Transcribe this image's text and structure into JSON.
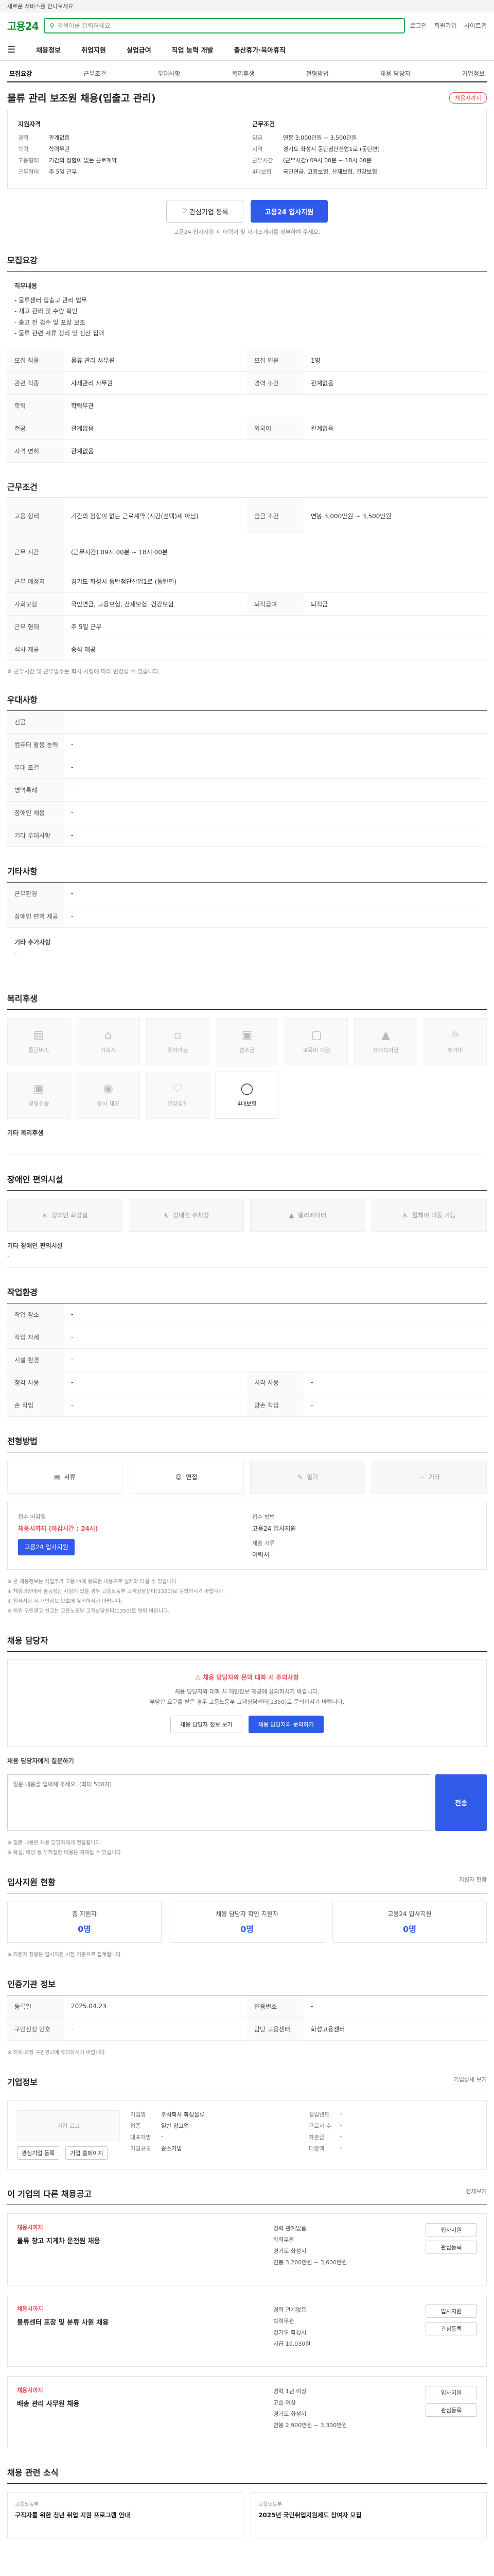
{
  "topbar": {
    "text": "새로운 서비스를 만나보세요"
  },
  "gnb": {
    "logo": "고용24",
    "search_placeholder": "검색어를 입력하세요",
    "links": [
      "로그인",
      "회원가입",
      "사이트맵"
    ]
  },
  "menu": {
    "items": [
      "채용정보",
      "취업지원",
      "실업급여",
      "직업 능력 개발",
      "출산휴가·육아휴직"
    ]
  },
  "tabs": [
    "모집요강",
    "근무조건",
    "우대사항",
    "복리후생",
    "전형방법",
    "채용 담당자",
    "기업정보"
  ],
  "job": {
    "title": "물류 관리 보조원 채용(입출고 관리)",
    "badge": "채용시까지",
    "summary_left_title": "지원자격",
    "summary_left": [
      {
        "k": "경력",
        "v": "관계없음"
      },
      {
        "k": "학력",
        "v": "학력무관"
      },
      {
        "k": "고용형태",
        "v": "기간의 정함이 없는 근로계약"
      },
      {
        "k": "근무형태",
        "v": "주 5일 근무"
      }
    ],
    "summary_right_title": "근무조건",
    "summary_right": [
      {
        "k": "임금",
        "v": "연봉 3,000만원 ~ 3,500만원"
      },
      {
        "k": "지역",
        "v": "경기도 화성시 동탄첨단산업1로 (동탄면)"
      },
      {
        "k": "근무시간",
        "v": "(근무시간) 09시 00분 ~ 18시 00분"
      },
      {
        "k": "4대보험",
        "v": "국민연금, 고용보험, 산재보험, 건강보험"
      }
    ],
    "btn_scrap": "관심기업 등록",
    "btn_apply": "고용24 입사지원",
    "note": "고용24 입사지원 시 이력서 및 자기소개서를 첨부하여 주세요."
  },
  "recruit": {
    "title": "모집요강",
    "job_desc_label": "직무내용",
    "job_desc": "- 물류센터 입출고 관리 업무\n- 재고 관리 및 수량 확인\n- 출고 전 검수 및 포장 보조\n- 물류 관련 서류 정리 및 전산 입력",
    "rows": [
      {
        "k1": "모집 직종",
        "v1": "물류 관리 사무원",
        "k2": "모집 인원",
        "v2": "1명"
      },
      {
        "k1": "관련 직종",
        "v1": "자재관리 사무원",
        "k2": "경력 조건",
        "v2": "관계없음"
      },
      {
        "k1": "학력",
        "v1": "학력무관",
        "k2": "",
        "v2": ""
      },
      {
        "k1": "전공",
        "v1": "관계없음",
        "k2": "외국어",
        "v2": "관계없음"
      },
      {
        "k1": "자격 면허",
        "v1": "관계없음",
        "k2": "",
        "v2": ""
      }
    ]
  },
  "conditions": {
    "title": "근무조건",
    "rows": [
      {
        "k1": "고용 형태",
        "v1": "기간의 정함이 없는 근로계약 (시간(선택)제 아님)",
        "k2": "임금 조건",
        "v2": "연봉 3,000만원 ~ 3,500만원"
      },
      {
        "k1": "근무 시간",
        "v1": "(근무시간) 09시 00분 ~ 18시 00분",
        "k2": "",
        "v2": ""
      },
      {
        "k1": "근무 예정지",
        "v1": "경기도 화성시 동탄첨단산업1로 (동탄면)",
        "k2": "",
        "v2": ""
      },
      {
        "k1": "사회보험",
        "v1": "국민연금, 고용보험, 산재보험, 건강보험",
        "k2": "퇴직급여",
        "v2": "퇴직금"
      },
      {
        "k1": "근무 형태",
        "v1": "주 5일 근무",
        "k2": "",
        "v2": ""
      },
      {
        "k1": "식사 제공",
        "v1": "중식 제공",
        "k2": "",
        "v2": ""
      }
    ],
    "note": "※ 근무시간 및 근무일수는 회사 사정에 따라 변경될 수 있습니다."
  },
  "prefer": {
    "title": "우대사항",
    "rows": [
      {
        "k": "전공",
        "v": "-"
      },
      {
        "k": "컴퓨터 활용 능력",
        "v": "-"
      },
      {
        "k": "우대 조건",
        "v": "-"
      },
      {
        "k": "병역특례",
        "v": "-"
      },
      {
        "k": "장애인 채용",
        "v": "-"
      },
      {
        "k": "기타 우대사항",
        "v": "-"
      }
    ]
  },
  "other": {
    "title": "기타사항",
    "rows": [
      {
        "k": "근무환경",
        "v": "-"
      },
      {
        "k": "장애인 편의 제공",
        "v": "-"
      }
    ],
    "extra_label": "기타 추가사항",
    "extra": "-"
  },
  "welfare": {
    "title": "복리후생",
    "items": [
      {
        "label": "통근버스",
        "icon": "bus-icon",
        "on": false
      },
      {
        "label": "기숙사",
        "icon": "home-icon",
        "on": false
      },
      {
        "label": "주차가능",
        "icon": "car-icon",
        "on": false
      },
      {
        "label": "경조금",
        "icon": "gift-icon",
        "on": false
      },
      {
        "label": "교육비 지원",
        "icon": "book-icon",
        "on": false
      },
      {
        "label": "자녀학자금",
        "icon": "school-icon",
        "on": false
      },
      {
        "label": "휴가비",
        "icon": "sun-icon",
        "on": false
      },
      {
        "label": "명절선물",
        "icon": "gift-icon",
        "on": false
      },
      {
        "label": "중식 제공",
        "icon": "meal-icon",
        "on": false
      },
      {
        "label": "건강검진",
        "icon": "heart-icon",
        "on": false
      },
      {
        "label": "4대보험",
        "icon": "shield-icon",
        "on": true
      }
    ],
    "extra_label": "기타 복리후생",
    "extra": "-"
  },
  "disability": {
    "title": "장애인 편의시설",
    "items": [
      "장애인 화장실",
      "장애인 주차장",
      "엘리베이터",
      "휠체어 이동 가능"
    ],
    "extra_label": "기타 장애인 편의시설",
    "extra": "-"
  },
  "workenv": {
    "title": "작업환경",
    "rows": [
      {
        "k1": "작업 장소",
        "v1": "-",
        "k2": "",
        "v2": ""
      },
      {
        "k1": "작업 자세",
        "v1": "-",
        "k2": "",
        "v2": ""
      },
      {
        "k1": "시설 환경",
        "v1": "-",
        "k2": "",
        "v2": ""
      },
      {
        "k1": "청각 사용",
        "v1": "-",
        "k2": "시각 사용",
        "v2": "-"
      },
      {
        "k1": "손 작업",
        "v1": "-",
        "k2": "양손 작업",
        "v2": "-"
      }
    ]
  },
  "selection": {
    "title": "전형방법",
    "steps": [
      "서류",
      "면접",
      "필기",
      "기타"
    ],
    "apply_label": "접수 마감일",
    "apply_deadline": "채용시까지 (마감시간 : 24시)",
    "method_label": "접수 방법",
    "method_value": "고용24 입사지원",
    "doc_label": "제출 서류",
    "doc_value": "이력서",
    "btn": "고용24 입사지원",
    "notices": [
      "※ 본 채용정보는 사업주가 고용24에 등록한 내용으로 실제와 다를 수 있습니다.",
      "※ 채용과정에서 불공정한 사항이 있을 경우 고용노동부 고객상담센터(1350)로 문의하시기 바랍니다.",
      "※ 입사지원 시 개인정보 보호에 유의하시기 바랍니다.",
      "※ 허위 구인광고 신고는 고용노동부 고객상담센터(1350)로 연락 바랍니다."
    ]
  },
  "contact": {
    "title": "채용 담당자",
    "warn": "채용 담당자와 문의 대화 시 주의사항",
    "desc": "채용 담당자와 대화 시 개인정보 제공에 유의하시기 바랍니다.\n부당한 요구를 받은 경우 고용노동부 고객상담센터(1350)로 문의하시기 바랍니다.",
    "btn1": "채용 담당자 정보 보기",
    "btn2": "채용 담당자와 문의하기",
    "inq_label": "채용 담당자에게 질문하기",
    "inq_placeholder": "질문 내용을 입력해 주세요. (최대 500자)",
    "inq_send": "전송",
    "notices": [
      "※ 질문 내용은 채용 담당자에게 전달됩니다.",
      "※ 욕설, 비방 등 부적절한 내용은 제재될 수 있습니다."
    ]
  },
  "stats": {
    "title": "입사지원 현황",
    "right": "지원자 현황",
    "items": [
      {
        "label": "총 지원자",
        "value": "0명"
      },
      {
        "label": "채용 담당자 확인 지원자",
        "value": "0명"
      },
      {
        "label": "고용24 입사지원",
        "value": "0명"
      }
    ],
    "note": "※ 지원자 현황은 입사지원 시점 기준으로 집계됩니다."
  },
  "admin": {
    "title": "인증기관 정보",
    "rows": [
      {
        "k1": "등록일",
        "v1": "2025.04.23",
        "k2": "인증번호",
        "v2": "-"
      },
      {
        "k1": "구인신청 번호",
        "v1": "-",
        "k2": "담당 고용센터",
        "v2": "화성고용센터"
      }
    ],
    "note": "※ 허위·과장 구인광고에 유의하시기 바랍니다."
  },
  "company": {
    "title": "기업정보",
    "right": "기업상세 보기",
    "logo_text": "기업 로고",
    "rows": [
      {
        "k": "기업명",
        "v": "주식회사 화성물류"
      },
      {
        "k": "업종",
        "v": "일반 창고업"
      },
      {
        "k": "대표자명",
        "v": "-"
      },
      {
        "k": "기업규모",
        "v": "중소기업"
      }
    ],
    "rows2": [
      {
        "k": "설립년도",
        "v": "-"
      },
      {
        "k": "근로자 수",
        "v": "-"
      },
      {
        "k": "자본금",
        "v": "-"
      },
      {
        "k": "매출액",
        "v": "-"
      }
    ],
    "btn1": "관심기업 등록",
    "btn2": "기업 홈페이지"
  },
  "similar": {
    "title": "이 기업의 다른 채용공고",
    "right": "전체보기",
    "cards": [
      {
        "tag": "채용시까지",
        "title": "물류 창고 지게차 운전원 채용",
        "info": [
          "경력 관계없음",
          "학력무관",
          "경기도 화성시",
          "연봉 3,200만원 ~ 3,600만원"
        ],
        "b1": "입사지원",
        "b2": "관심등록"
      },
      {
        "tag": "채용시까지",
        "title": "물류센터 포장 및 분류 사원 채용",
        "info": [
          "경력 관계없음",
          "학력무관",
          "경기도 화성시",
          "시급 10,030원"
        ],
        "b1": "입사지원",
        "b2": "관심등록"
      },
      {
        "tag": "채용시까지",
        "title": "배송 관리 사무원 채용",
        "info": [
          "경력 1년 이상",
          "고졸 이상",
          "경기도 화성시",
          "연봉 2,900만원 ~ 3,300만원"
        ],
        "b1": "입사지원",
        "b2": "관심등록"
      }
    ]
  },
  "news": {
    "title": "채용 관련 소식",
    "items": [
      {
        "src": "고용노동부",
        "title": "구직자를 위한 청년 취업 지원 프로그램 안내"
      },
      {
        "src": "고용노동부",
        "title": "2025년 국민취업지원제도 참여자 모집"
      }
    ]
  }
}
